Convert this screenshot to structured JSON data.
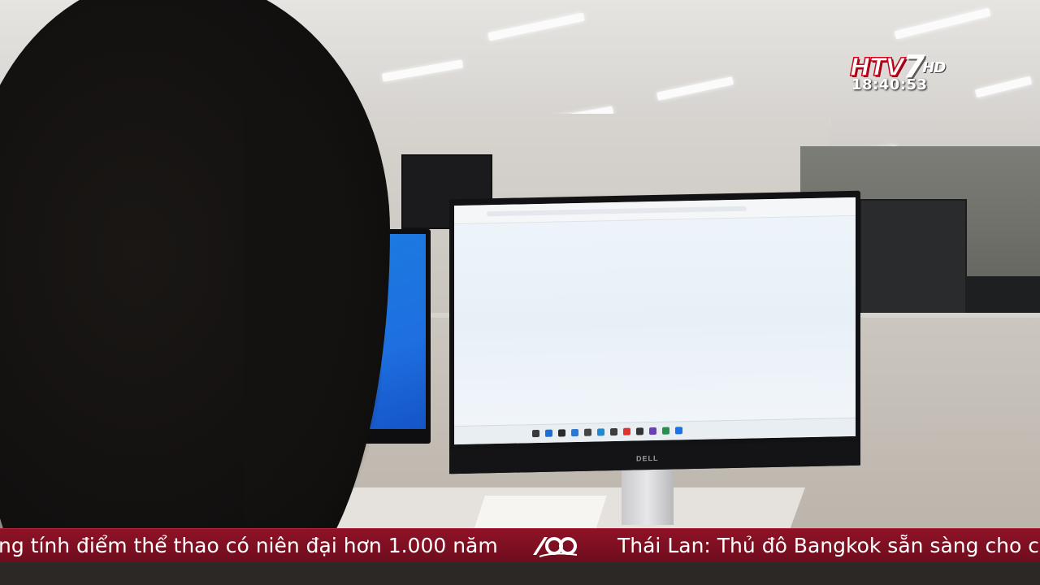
{
  "channel": {
    "logo_main": "HTV",
    "logo_number": "7",
    "logo_suffix": "HD",
    "clock": "18:40:53"
  },
  "ticker": {
    "item1": "ng tính điểm thể thao có niên đại hơn 1.000 năm",
    "item2": "Thái Lan: Thủ đô Bangkok sẵn sàng cho các",
    "separator_icon": "htv-60-years-icon"
  },
  "scene": {
    "monitor_brand": "DELL",
    "left_screen_color": "#1e6fe0",
    "ticker_color": "#8f1227"
  }
}
